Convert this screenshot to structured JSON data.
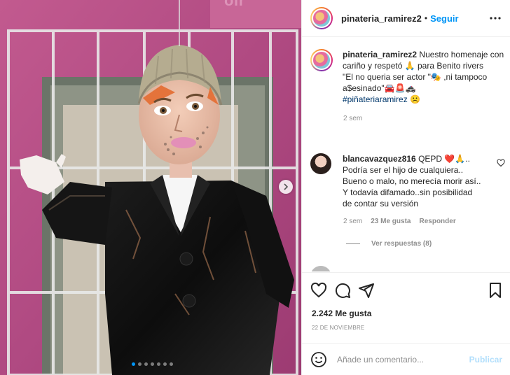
{
  "post": {
    "dots_total": 7,
    "dots_active": 1
  },
  "header": {
    "username": "pinateria_ramirez2",
    "separator": "•",
    "follow_label": "Seguir"
  },
  "caption": {
    "username": "pinateria_ramirez2",
    "line1": "Nuestro homenaje con cariño y respetó 🙏 para Benito rivers",
    "line2": "\"El no queria ser actor \"🎭 ,ni tampoco a$esinado\"🚘🚨🚓",
    "hashtag": "#piñateriaramirez",
    "hashtag_emoji": "☹️",
    "time": "2 sem"
  },
  "comment": {
    "username": "blancavazquez816",
    "text_head": "QEPD ❤️🙏..",
    "lines": [
      "Podría ser el hijo de cualquiera..",
      "Bueno o malo, no merecía morir así..",
      "Y todavía difamado..sin posibilidad",
      "de contar su versión"
    ],
    "time": "2 sem",
    "likes": "23 Me gusta",
    "reply_label": "Responder",
    "view_replies": "Ver respuestas (8)"
  },
  "actions": {
    "likes_count": "2.242",
    "likes_label": "Me gusta",
    "date": "22 DE NOVIEMBRE"
  },
  "comment_box": {
    "placeholder": "Añade un comentario...",
    "publish_label": "Publicar"
  },
  "colors": {
    "accent": "#0095f6",
    "publish_disabled": "#b2dffc",
    "wall_pink": "#b5487f"
  }
}
